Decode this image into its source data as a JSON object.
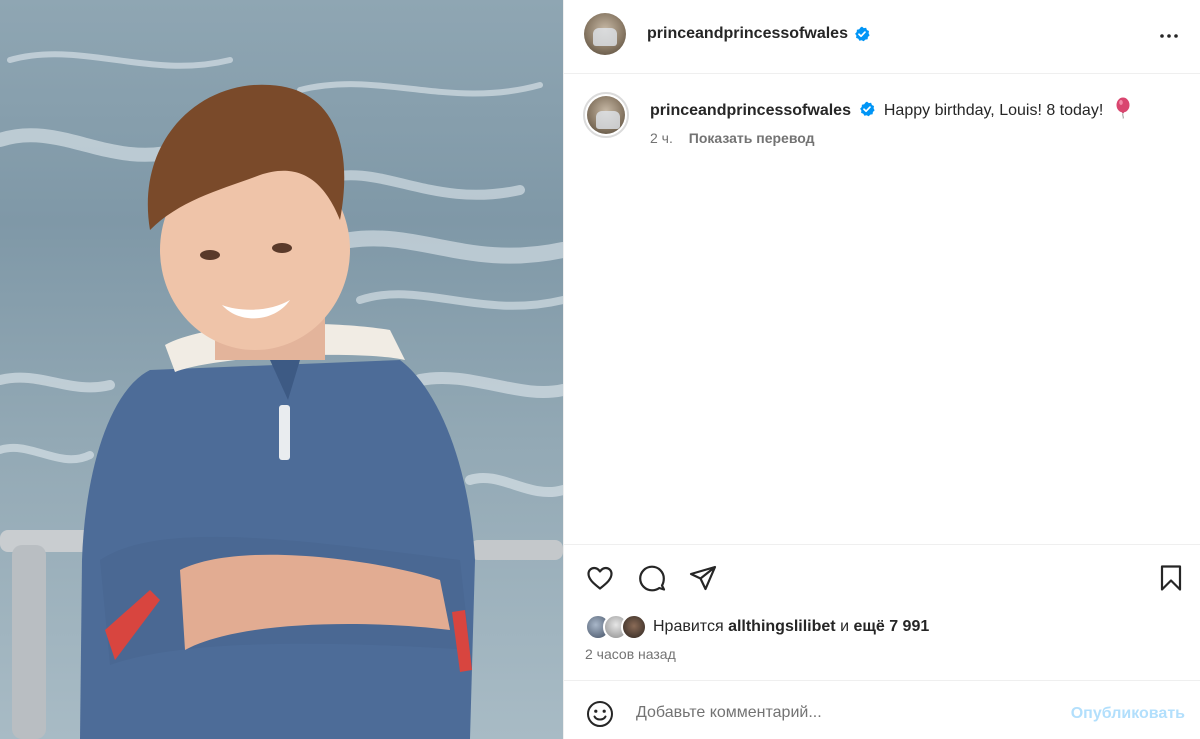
{
  "post": {
    "username": "princeandprincessofwales",
    "verified": true,
    "caption": "Happy birthday, Louis! 8 today!",
    "caption_emoji": "balloon-icon",
    "posted_ago": "2 ч.",
    "translate_label": "Показать перевод"
  },
  "likes": {
    "prefix": "Нравится",
    "user": "allthingslilibet",
    "connector": "и",
    "more": "ещё 7 991"
  },
  "timestamp": "2 часов назад",
  "comment": {
    "placeholder": "Добавьте комментарий...",
    "publish_label": "Опубликовать"
  },
  "colors": {
    "verified_blue": "#0095f6",
    "publish_disabled": "#b2dffc",
    "secondary_text": "#737373"
  }
}
